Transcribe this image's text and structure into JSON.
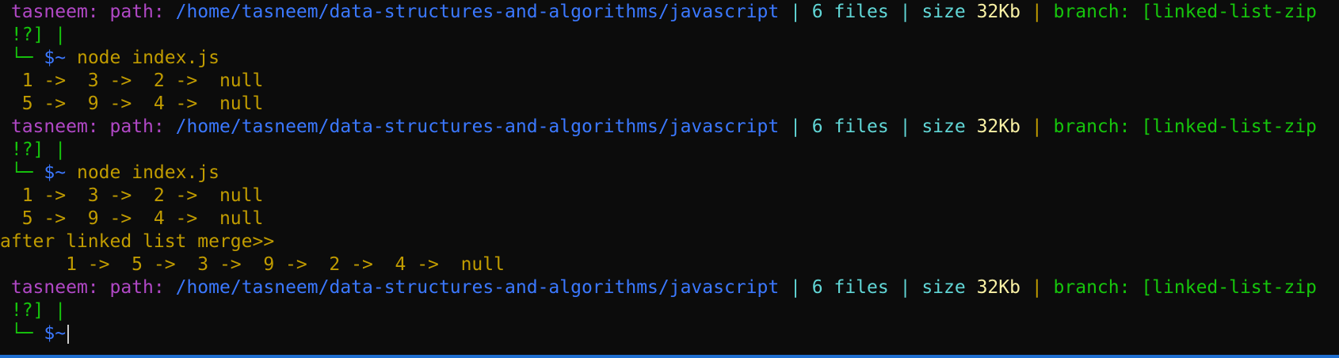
{
  "prompt": {
    "user": "tasneem:",
    "path_label": "path:",
    "path": "/home/tasneem/data-structures-and-algorithms/javascript",
    "sep": "|",
    "files": "6 files",
    "size_label": "size",
    "size_value": "32Kb",
    "branch_label": "branch:",
    "branch": "[linked-list-zip",
    "branch_cont": "!?]",
    "branch_sep": "|",
    "tree": "└─",
    "dollar": "$~"
  },
  "blocks": [
    {
      "command": "node index.js",
      "output": [
        "  1 ->  3 ->  2 ->  null",
        "  5 ->  9 ->  4 ->  null"
      ]
    },
    {
      "command": "node index.js",
      "output": [
        "  1 ->  3 ->  2 ->  null",
        "  5 ->  9 ->  4 ->  null",
        "after linked list merge>>",
        "      1 ->  5 ->  3 ->  9 ->  2 ->  4 ->  null"
      ]
    }
  ],
  "colors": {
    "background": "#0c0c0c",
    "user": "#b148c6",
    "path": "#3b78ff",
    "cyan": "#61d6d6",
    "output": "#c19c00",
    "branch": "#16c60c"
  }
}
